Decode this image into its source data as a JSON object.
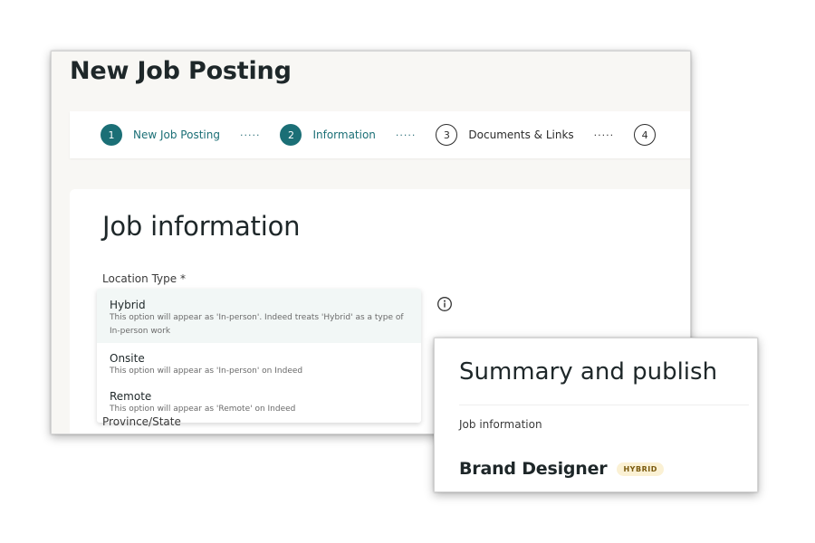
{
  "main": {
    "page_title": "New Job Posting",
    "stepper": {
      "steps": [
        {
          "number": "1",
          "label": "New Job Posting",
          "state": "active"
        },
        {
          "number": "2",
          "label": "Information",
          "state": "active"
        },
        {
          "number": "3",
          "label": "Documents & Links",
          "state": "pending"
        },
        {
          "number": "4",
          "label": "",
          "state": "pending"
        }
      ],
      "separator": "·····"
    },
    "card": {
      "title": "Job information",
      "location_label": "Location Type *",
      "location_options": [
        {
          "label": "Hybrid",
          "description": "This option will appear as 'In-person'. Indeed treats 'Hybrid' as a type of In-person work",
          "selected": true
        },
        {
          "label": "Onsite",
          "description": "This option will appear as 'In-person' on Indeed",
          "selected": false
        },
        {
          "label": "Remote",
          "description": "This option will appear as 'Remote' on Indeed",
          "selected": false
        }
      ],
      "next_field_label": "Province/State",
      "info_icon": "info-circle-icon"
    }
  },
  "summary": {
    "title": "Summary and publish",
    "section_label": "Job information",
    "job_title": "Brand Designer",
    "badge": "HYBRID"
  },
  "colors": {
    "accent": "#1b6f76",
    "badge_bg": "#fbf1d4",
    "badge_text": "#7a5a0e"
  }
}
